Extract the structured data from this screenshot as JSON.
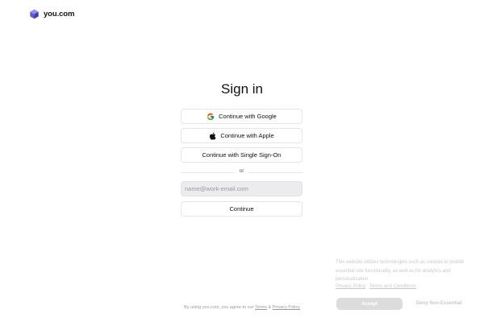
{
  "brand": {
    "name": "you.com",
    "logo_icon": "cube-icon",
    "color": "#5b5fd6"
  },
  "signin": {
    "title": "Sign in",
    "google_label": "Continue with Google",
    "apple_label": "Continue with Apple",
    "sso_label": "Continue with Single Sign-On",
    "divider_text": "or",
    "email_placeholder": "name@work-email.com",
    "email_value": "",
    "continue_label": "Continue"
  },
  "legal": {
    "prefix": "By using you.com, you agree to our",
    "terms_label": "Terms",
    "joiner": "&",
    "privacy_label": "Privacy Policy"
  },
  "cookie": {
    "text": "This website utilizes technologies such as cookies to enable essential site functionality, as well as for analytics and personalization.",
    "privacy_link": "Privacy Policy",
    "terms_link": "Terms and Conditions",
    "accept_label": "Accept",
    "deny_label": "Deny Non-Essential"
  }
}
